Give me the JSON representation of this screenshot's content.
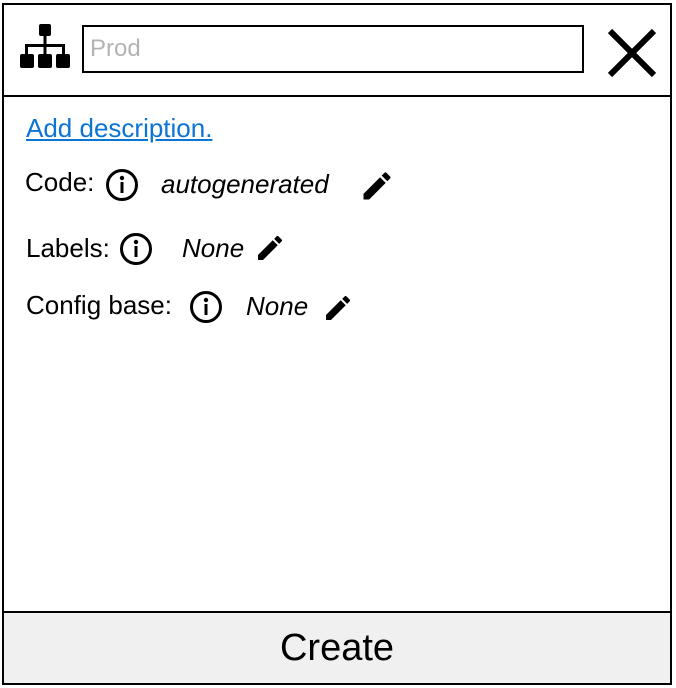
{
  "header": {
    "icon": "hierarchy-icon",
    "name_input": {
      "value": "",
      "placeholder": "Prod"
    },
    "close_icon": "close-icon"
  },
  "description_link": "Add description.",
  "fields": {
    "code": {
      "label": "Code:",
      "value": "autogenerated"
    },
    "labels": {
      "label": "Labels:",
      "value": "None"
    },
    "config_base": {
      "label": "Config base:",
      "value": "None"
    }
  },
  "footer": {
    "create_label": "Create"
  },
  "colors": {
    "link": "#0b74d5",
    "footer_bg": "#f0f0f0",
    "placeholder": "#b3b3b3"
  }
}
